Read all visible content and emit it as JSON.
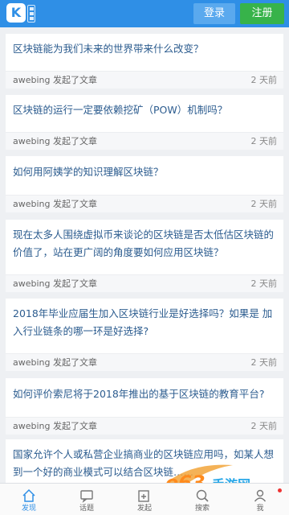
{
  "header": {
    "logo_letter": "K",
    "login_label": "登录",
    "register_label": "注册",
    "colors": {
      "brand": "#2f8fe6",
      "register": "#37b34a"
    }
  },
  "feed": {
    "posts": [
      {
        "title": "区块链能为我们未来的世界带来什么改变？",
        "author": "awebing",
        "action": "发起了文章",
        "time": "2 天前"
      },
      {
        "title": "区块链的运行一定要依赖挖矿（POW）机制吗？",
        "author": "awebing",
        "action": "发起了文章",
        "time": "2 天前"
      },
      {
        "title": "如何用阿姨学的知识理解区块链？",
        "author": "awebing",
        "action": "发起了文章",
        "time": "2 天前"
      },
      {
        "title": "现在太多人围绕虚拟币来谈论的区块链是否太低估区块链的价值了，站在更广阔的角度要如何应用区块链？",
        "author": "awebing",
        "action": "发起了文章",
        "time": "2 天前"
      },
      {
        "title": "2018年毕业应届生加入区块链行业是好选择吗？如果是 加入行业链条的哪一环是好选择?",
        "author": "awebing",
        "action": "发起了文章",
        "time": "2 天前"
      },
      {
        "title": "如何评价索尼将于2018年推出的基于区块链的教育平台?",
        "author": "awebing",
        "action": "发起了文章",
        "time": "2 天前"
      },
      {
        "title": "国家允许个人或私营企业搞商业的区块链应用吗，如某人想到一个好的商业模式可以结合区块链……",
        "author": "",
        "action": "",
        "time": ""
      }
    ]
  },
  "bottom_nav": {
    "tabs": [
      {
        "label": "发现",
        "icon": "home-icon"
      },
      {
        "label": "话题",
        "icon": "chat-icon"
      },
      {
        "label": "发起",
        "icon": "compose-icon"
      },
      {
        "label": "搜索",
        "icon": "search-icon"
      },
      {
        "label": "我",
        "icon": "user-icon"
      }
    ],
    "active_tab": "发现"
  },
  "watermark": {
    "text": "e63手游网"
  }
}
